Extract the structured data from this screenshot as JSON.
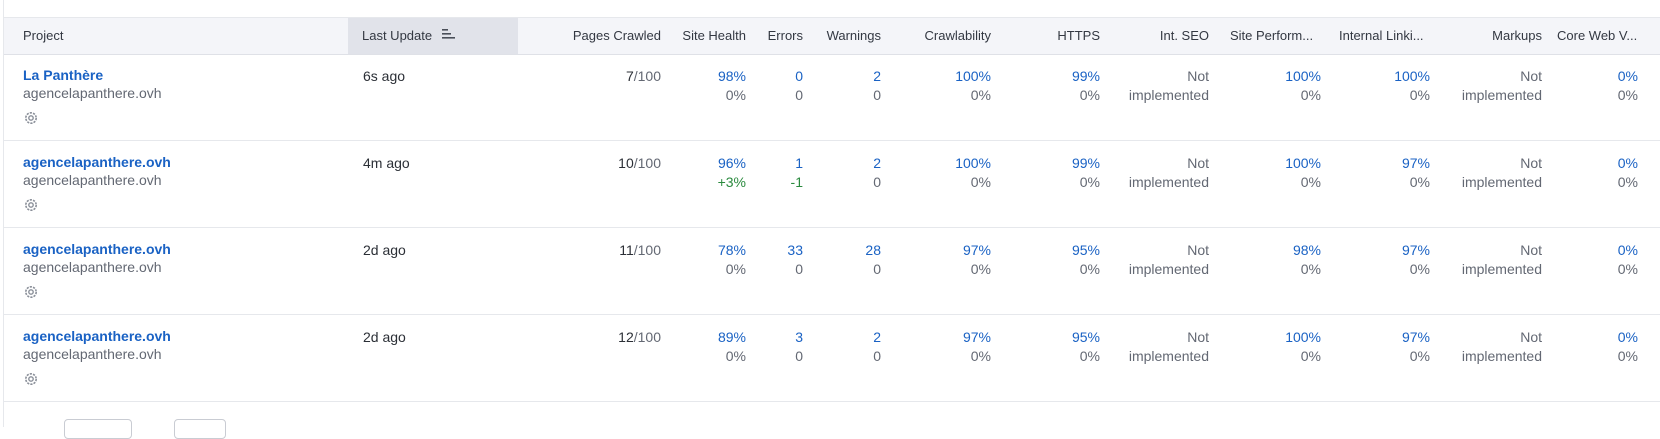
{
  "columns": {
    "project": "Project",
    "last_update": "Last Update",
    "pages_crawled": "Pages Crawled",
    "site_health": "Site Health",
    "errors": "Errors",
    "warnings": "Warnings",
    "crawlability": "Crawlability",
    "https": "HTTPS",
    "int_seo": "Int. SEO",
    "site_performance": "Site Perform...",
    "internal_linking": "Internal Linki...",
    "markups": "Markups",
    "core_web_vitals": "Core Web V..."
  },
  "rows": [
    {
      "name": "La Panthère",
      "domain": "agencelapanthere.ovh",
      "last_update": "6s ago",
      "pages": "7",
      "pages_limit": "/100",
      "site_health": "98%",
      "site_health_delta": "0%",
      "errors": "0",
      "errors_delta": "0",
      "warnings": "2",
      "warnings_delta": "0",
      "crawlability": "100%",
      "crawlability_delta": "0%",
      "https": "99%",
      "https_delta": "0%",
      "int_seo_1": "Not",
      "int_seo_2": "implemented",
      "site_perf": "100%",
      "site_perf_delta": "0%",
      "internal_linking": "100%",
      "internal_linking_delta": "0%",
      "markups_1": "Not",
      "markups_2": "implemented",
      "cwv": "0%",
      "cwv_delta": "0%"
    },
    {
      "name": "agencelapanthere.ovh",
      "domain": "agencelapanthere.ovh",
      "last_update": "4m ago",
      "pages": "10",
      "pages_limit": "/100",
      "site_health": "96%",
      "site_health_delta": "+3%",
      "errors": "1",
      "errors_delta": "-1",
      "warnings": "2",
      "warnings_delta": "0",
      "crawlability": "100%",
      "crawlability_delta": "0%",
      "https": "99%",
      "https_delta": "0%",
      "int_seo_1": "Not",
      "int_seo_2": "implemented",
      "site_perf": "100%",
      "site_perf_delta": "0%",
      "internal_linking": "97%",
      "internal_linking_delta": "0%",
      "markups_1": "Not",
      "markups_2": "implemented",
      "cwv": "0%",
      "cwv_delta": "0%"
    },
    {
      "name": "agencelapanthere.ovh",
      "domain": "agencelapanthere.ovh",
      "last_update": "2d ago",
      "pages": "11",
      "pages_limit": "/100",
      "site_health": "78%",
      "site_health_delta": "0%",
      "errors": "33",
      "errors_delta": "0",
      "warnings": "28",
      "warnings_delta": "0",
      "crawlability": "97%",
      "crawlability_delta": "0%",
      "https": "95%",
      "https_delta": "0%",
      "int_seo_1": "Not",
      "int_seo_2": "implemented",
      "site_perf": "98%",
      "site_perf_delta": "0%",
      "internal_linking": "97%",
      "internal_linking_delta": "0%",
      "markups_1": "Not",
      "markups_2": "implemented",
      "cwv": "0%",
      "cwv_delta": "0%"
    },
    {
      "name": "agencelapanthere.ovh",
      "domain": "agencelapanthere.ovh",
      "last_update": "2d ago",
      "pages": "12",
      "pages_limit": "/100",
      "site_health": "89%",
      "site_health_delta": "0%",
      "errors": "3",
      "errors_delta": "0",
      "warnings": "2",
      "warnings_delta": "0",
      "crawlability": "97%",
      "crawlability_delta": "0%",
      "https": "95%",
      "https_delta": "0%",
      "int_seo_1": "Not",
      "int_seo_2": "implemented",
      "site_perf": "100%",
      "site_perf_delta": "0%",
      "internal_linking": "97%",
      "internal_linking_delta": "0%",
      "markups_1": "Not",
      "markups_2": "implemented",
      "cwv": "0%",
      "cwv_delta": "0%"
    }
  ],
  "colors": {
    "link": "#1a62c4",
    "positive": "#2a8a3e",
    "muted": "#636873",
    "header_bg": "#f4f5f9",
    "sorted_bg": "#e1e3ea"
  },
  "icons": {
    "sort": "sort-descending-icon",
    "settings": "gear-icon"
  }
}
